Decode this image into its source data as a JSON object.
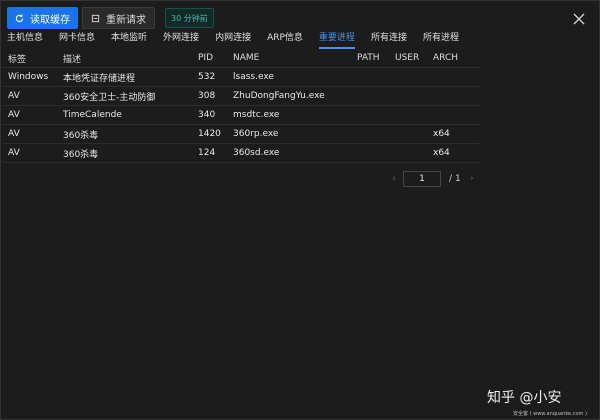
{
  "toolbar": {
    "read_cache_label": "读取缓存",
    "re_request_label": "重新请求",
    "time_badge": "30 分钟前"
  },
  "tabs": [
    {
      "label": "主机信息",
      "active": false
    },
    {
      "label": "网卡信息",
      "active": false
    },
    {
      "label": "本地监听",
      "active": false
    },
    {
      "label": "外网连接",
      "active": false
    },
    {
      "label": "内网连接",
      "active": false
    },
    {
      "label": "ARP信息",
      "active": false
    },
    {
      "label": "重要进程",
      "active": true
    },
    {
      "label": "所有连接",
      "active": false
    },
    {
      "label": "所有进程",
      "active": false
    }
  ],
  "table": {
    "headers": [
      "标签",
      "描述",
      "PID",
      "NAME",
      "PATH",
      "USER",
      "ARCH"
    ],
    "rows": [
      [
        "Windows",
        "本地凭证存储进程",
        "532",
        "lsass.exe",
        "",
        "",
        ""
      ],
      [
        "AV",
        "360安全卫士-主动防御",
        "308",
        "ZhuDongFangYu.exe",
        "",
        "",
        ""
      ],
      [
        "AV",
        "TimeCalende",
        "340",
        "msdtc.exe",
        "",
        "",
        ""
      ],
      [
        "AV",
        "360杀毒",
        "1420",
        "360rp.exe",
        "",
        "",
        "x64"
      ],
      [
        "AV",
        "360杀毒",
        "124",
        "360sd.exe",
        "",
        "",
        "x64"
      ]
    ]
  },
  "pager": {
    "prev": "‹",
    "current": "1",
    "separator": "/",
    "total": "1",
    "next": "›"
  },
  "watermark": "知乎 @小安",
  "source_text": "安全客 ( www.anquanke.com )",
  "colors": {
    "accent": "#1a73e8",
    "active_tab": "#4a90e2",
    "badge_text": "#4db6ac"
  },
  "icons": {
    "read_cache": "refresh-icon",
    "re_request": "clear-icon",
    "close": "close-icon"
  }
}
